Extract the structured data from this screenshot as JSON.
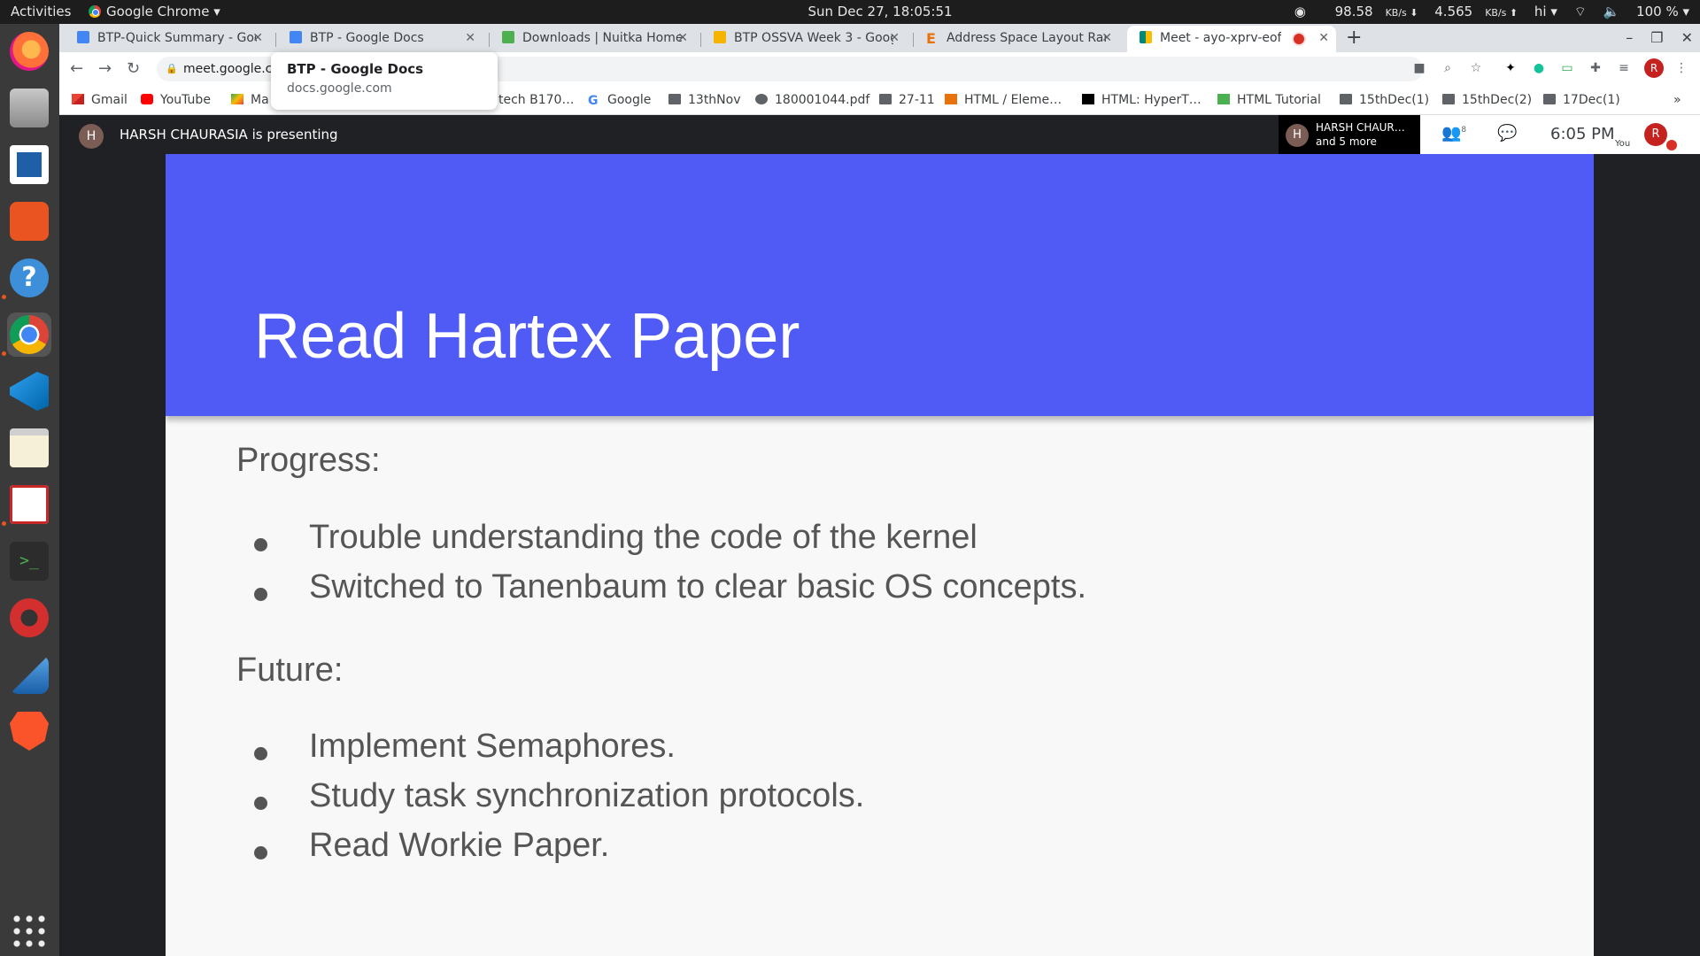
{
  "system_bar": {
    "activities": "Activities",
    "app_name": "Google Chrome ▾",
    "clock": "Sun Dec 27, 18:05:51",
    "net_down": "98.58",
    "net_down_unit": "KB/s ⬇",
    "net_up": "4.565",
    "net_up_unit": "KB/s ⬆",
    "lang": "hi ▾",
    "battery": "100 % ▾"
  },
  "dock": {
    "apps": [
      "Firefox",
      "Files",
      "LibreOffice Writer",
      "Ubuntu Software",
      "Help",
      "Google Chrome",
      "Visual Studio Code",
      "Text Editor",
      "Evince",
      "Terminal",
      "Anbox",
      "Wireshark",
      "Brave",
      "Show Applications"
    ]
  },
  "browser": {
    "tabs": [
      {
        "title": "BTP-Quick Summary - Goo",
        "favicon_color": "#4285f4"
      },
      {
        "title": "BTP - Google Docs",
        "favicon_color": "#4285f4"
      },
      {
        "title": "Downloads | Nuitka Home",
        "favicon_color": "#4caf50"
      },
      {
        "title": "BTP OSSVA Week 3 - Goog",
        "favicon_color": "#f4b400"
      },
      {
        "title": "Address Space Layout Ran",
        "favicon_color": "#e8710a"
      },
      {
        "title": "Meet - ayo-xprv-eof",
        "favicon_color": "#00897b"
      }
    ],
    "new_tab": "+",
    "url": "meet.google.co",
    "tooltip": {
      "title": "BTP - Google Docs",
      "domain": "docs.google.com"
    },
    "bookmarks": [
      "Gmail",
      "YouTube",
      "Ma",
      "tech B170…",
      "Google",
      "13thNov",
      "180001044.pdf",
      "27-11",
      "HTML / Eleme…",
      "HTML: HyperT…",
      "HTML Tutorial",
      "15thDec(1)",
      "15thDec(2)",
      "17Dec(1)"
    ],
    "bookmarks_more": "»"
  },
  "meet": {
    "presenter_initial": "H",
    "presenting_text": "HARSH CHAURASIA is presenting",
    "participants_name": "HARSH CHAUR…",
    "participants_more": "and 5 more",
    "people_count": "8",
    "time": "6:05  PM",
    "you_label": "You",
    "you_initial": "R"
  },
  "slide": {
    "title": "Read Hartex Paper",
    "progress_heading": "Progress:",
    "progress_items": [
      "Trouble understanding the code of the kernel",
      "Switched to Tanenbaum to clear basic OS concepts."
    ],
    "future_heading": "Future:",
    "future_items": [
      "Implement Semaphores.",
      "Study task synchronization protocols.",
      "Read Workie Paper."
    ]
  },
  "colors": {
    "slide_header": "#4f5bf4",
    "meet_bg": "#202124",
    "dock_bg": "#3a3a3a"
  }
}
